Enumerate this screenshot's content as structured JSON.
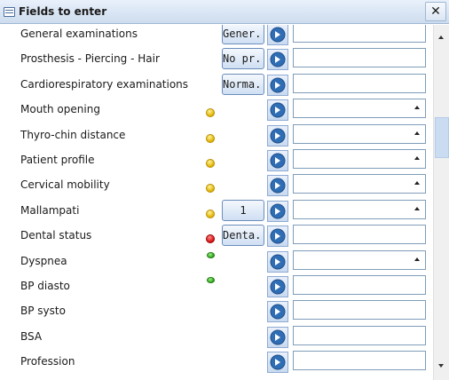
{
  "window": {
    "title": "Fields to enter",
    "close_label": "✕"
  },
  "rows": [
    {
      "label": "General examinations",
      "value_btn": "Gener...",
      "field": "text"
    },
    {
      "label": "Prosthesis - Piercing - Hair",
      "value_btn": "No pr...",
      "field": "text"
    },
    {
      "label": "Cardiorespiratory examinations",
      "value_btn": "Norma...",
      "field": "text"
    },
    {
      "label": "Mouth opening",
      "indicator": "yellow",
      "field": "dropdown"
    },
    {
      "label": "Thyro-chin distance",
      "indicator": "yellow",
      "field": "dropdown"
    },
    {
      "label": "Patient profile",
      "indicator": "yellow",
      "field": "dropdown"
    },
    {
      "label": "Cervical mobility",
      "indicator": "yellow",
      "field": "dropdown"
    },
    {
      "label": "Mallampati",
      "indicator": "yellow",
      "value_btn": "1",
      "field": "dropdown"
    },
    {
      "label": "Dental status",
      "indicator": "red",
      "value_btn": "Denta...",
      "field": "text"
    },
    {
      "label": "Dyspnea",
      "indicator": "green",
      "field": "dropdown"
    },
    {
      "label": "BP diasto",
      "indicator": "green",
      "field": "text"
    },
    {
      "label": "BP systo",
      "field": "text"
    },
    {
      "label": "BSA",
      "field": "text"
    },
    {
      "label": "Profession",
      "field": "text"
    }
  ],
  "colors": {
    "accent": "#2f6db5",
    "indicator_yellow": "#f0c400",
    "indicator_red": "#d41010",
    "indicator_green": "#2ea41a"
  },
  "icons": {
    "title": "form-icon",
    "row_action": "arrow-right-circle-icon",
    "dropdown": "caret-icon"
  }
}
